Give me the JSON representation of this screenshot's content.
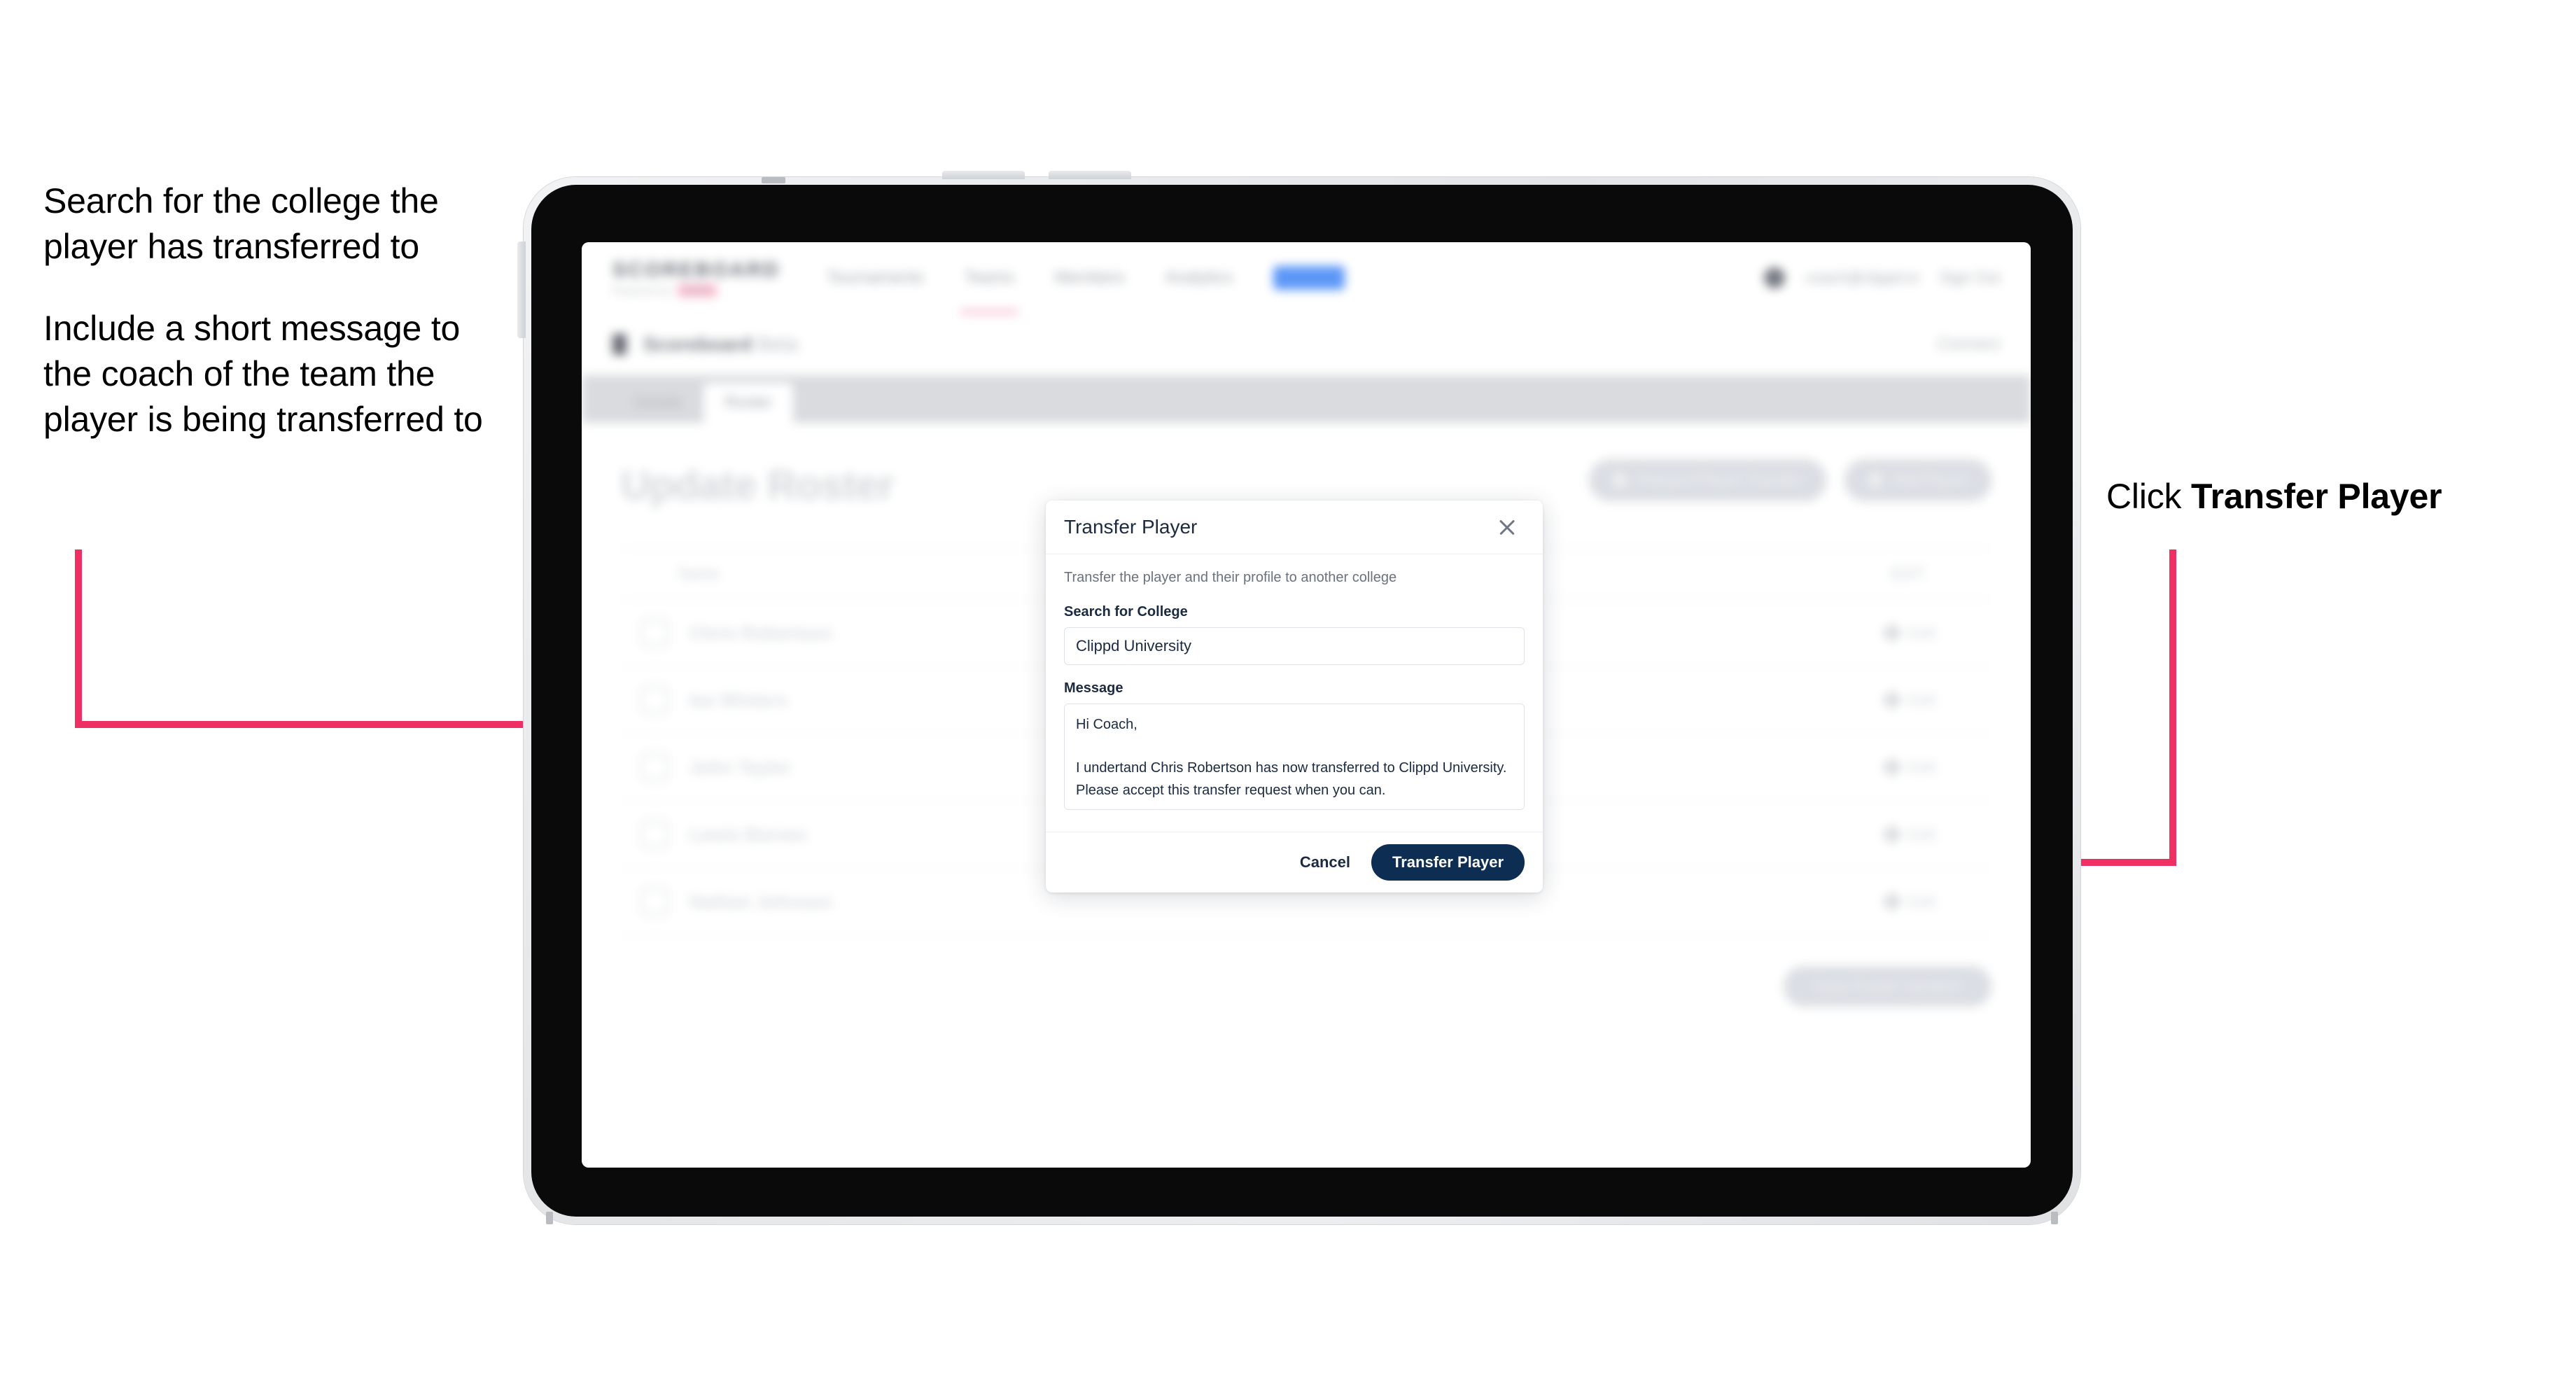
{
  "annotations": {
    "left": [
      "Search for the college the player has transferred to",
      "Include a short message to the coach of the team the player is being transferred to"
    ],
    "right_prefix": "Click ",
    "right_bold": "Transfer Player",
    "arrow_color": "#ed2f63"
  },
  "app": {
    "nav": {
      "logo": "SCOREBOARD",
      "logo_sub": "Powered by",
      "logo_badge": "NEW",
      "links": [
        {
          "label": "Tournaments",
          "state": "normal"
        },
        {
          "label": "Teams",
          "state": "underlined"
        },
        {
          "label": "Members",
          "state": "normal"
        },
        {
          "label": "Analytics",
          "state": "normal"
        }
      ],
      "chip": "Admin",
      "user": "coach@clippd.io",
      "sign_out": "Sign Out"
    },
    "subheader": {
      "title": "Scoreboard",
      "title_muted": "Beta",
      "right": "Connect"
    },
    "tabs": [
      {
        "label": "Details",
        "active": false
      },
      {
        "label": "Roster",
        "active": true
      }
    ],
    "page_title": "Update Roster",
    "header_actions": [
      {
        "label": "Request Player Transfer",
        "icon": "transfer-icon"
      },
      {
        "label": "Add Player",
        "icon": "plus-icon"
      }
    ],
    "table": {
      "columns": {
        "name": "Name",
        "action": "EDIT"
      },
      "rows": [
        {
          "name": "Chris Robertson",
          "action": "Edit"
        },
        {
          "name": "Ian Winters",
          "action": "Edit"
        },
        {
          "name": "John Taylor",
          "action": "Edit"
        },
        {
          "name": "Lewis Barnes",
          "action": "Edit"
        },
        {
          "name": "Nathan Johnson",
          "action": "Edit"
        }
      ]
    },
    "footer_button": "Save Roster Updates"
  },
  "modal": {
    "title": "Transfer Player",
    "close_icon": "close-icon",
    "description": "Transfer the player and their profile to another college",
    "college_label": "Search for College",
    "college_value": "Clippd University",
    "college_placeholder": "Search for College",
    "message_label": "Message",
    "message_value": "Hi Coach,\n\nI undertand Chris Robertson has now transferred to Clippd University. Please accept this transfer request when you can.",
    "message_placeholder": "Message",
    "cancel_label": "Cancel",
    "submit_label": "Transfer Player",
    "submit_color": "#0d2d52"
  }
}
